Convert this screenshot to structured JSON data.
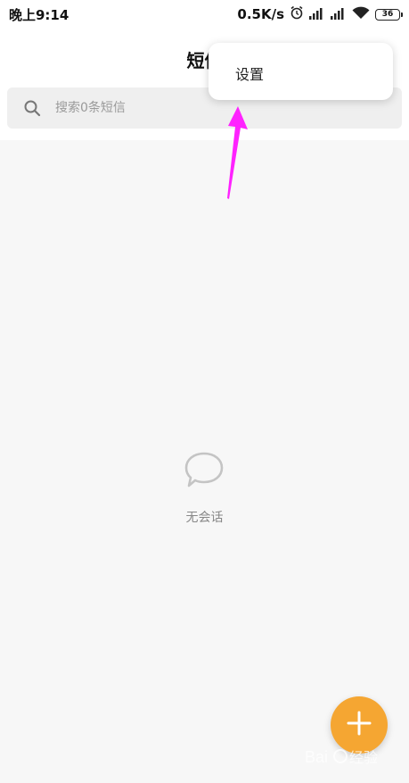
{
  "status_bar": {
    "time": "晚上9:14",
    "net_speed": "0.5K/s",
    "battery_level": "36",
    "icons": [
      "alarm-icon",
      "signal-icon",
      "signal-icon",
      "wifi-icon",
      "battery-icon"
    ]
  },
  "header": {
    "title": "短信"
  },
  "search": {
    "placeholder": "搜索0条短信"
  },
  "popup_menu": {
    "items": [
      {
        "label": "设置"
      }
    ]
  },
  "empty_state": {
    "icon": "chat-bubble-icon",
    "text": "无会话"
  },
  "fab": {
    "icon": "plus-icon",
    "color": "#f5a632"
  },
  "overlay": {
    "arrow_color": "#ff22ff"
  },
  "colors": {
    "accent": "#f5a632",
    "arrow": "#ff22ff"
  }
}
